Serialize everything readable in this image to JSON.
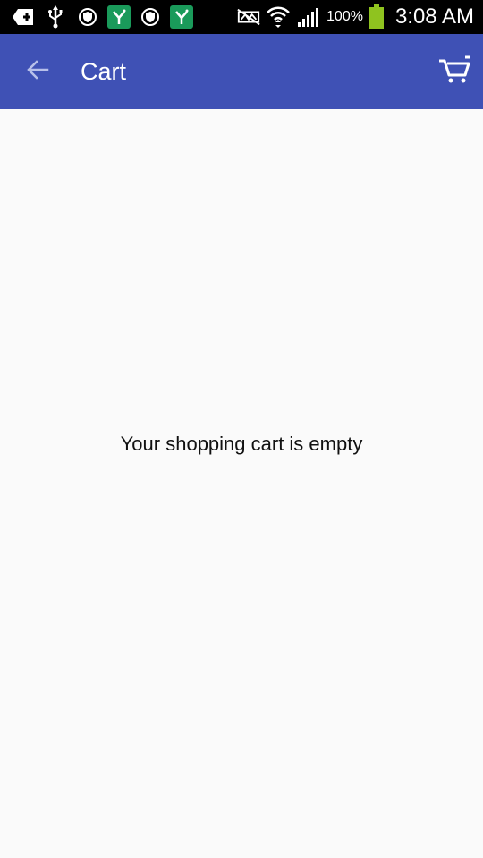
{
  "status_bar": {
    "battery_percent": "100%",
    "time": "3:08 AM",
    "battery_color": "#8fc31f"
  },
  "app_bar": {
    "title": "Cart",
    "back_icon": "arrow-back-icon",
    "cart_icon": "shopping-cart-icon",
    "color": "#3f51b5"
  },
  "main": {
    "empty_message": "Your shopping cart is empty"
  }
}
